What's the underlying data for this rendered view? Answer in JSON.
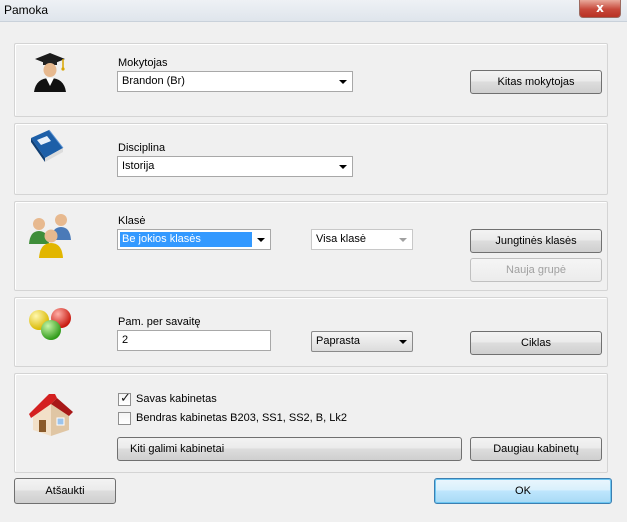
{
  "window": {
    "title": "Pamoka",
    "close_glyph": "x"
  },
  "teacher": {
    "label": "Mokytojas",
    "value": "Brandon (Br)",
    "other_button": "Kitas mokytojas",
    "icon": "graduate-icon"
  },
  "discipline": {
    "label": "Disciplina",
    "value": "Istorija",
    "icon": "book-icon"
  },
  "class": {
    "label": "Klasė",
    "value": "Be jokios klasės",
    "group_value": "Visa klasė",
    "joint_button": "Jungtinės klasės",
    "new_group_button": "Nauja grupė",
    "icon": "people-icon"
  },
  "per_week": {
    "label": "Pam. per savaitę",
    "value": "2",
    "type_value": "Paprasta",
    "cycles_button": "Ciklas",
    "icon": "balls-icon"
  },
  "rooms": {
    "own_room_label": "Savas kabinetas",
    "own_room_checked": true,
    "shared_room_label": "Bendras kabinetas B203, SS1, SS2, B, Lk2",
    "shared_room_checked": false,
    "other_rooms_button": "Kiti galimi kabinetai",
    "more_rooms_button": "Daugiau kabinetų",
    "icon": "house-icon"
  },
  "footer": {
    "cancel_button": "Atšaukti",
    "ok_button": "OK"
  },
  "colors": {
    "selection": "#3399ff",
    "ok_border": "#3c7fb1"
  }
}
